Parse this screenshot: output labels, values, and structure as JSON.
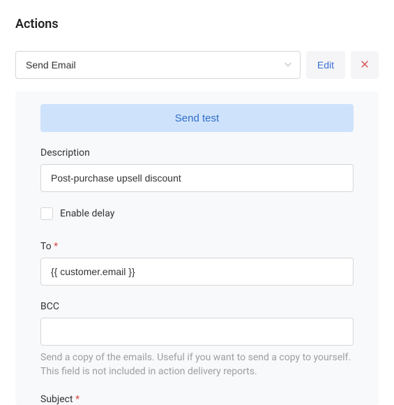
{
  "title": "Actions",
  "select": {
    "value": "Send Email"
  },
  "buttons": {
    "edit": "Edit",
    "send_test": "Send test"
  },
  "fields": {
    "description": {
      "label": "Description",
      "value": "Post-purchase upsell discount"
    },
    "enable_delay": {
      "label": "Enable delay",
      "checked": false
    },
    "to": {
      "label": "To",
      "value": "{{ customer.email }}"
    },
    "bcc": {
      "label": "BCC",
      "value": "",
      "help": "Send a copy of the emails. Useful if you want to send a copy to yourself. This field is not included in action delivery reports."
    },
    "subject": {
      "label": "Subject"
    }
  }
}
